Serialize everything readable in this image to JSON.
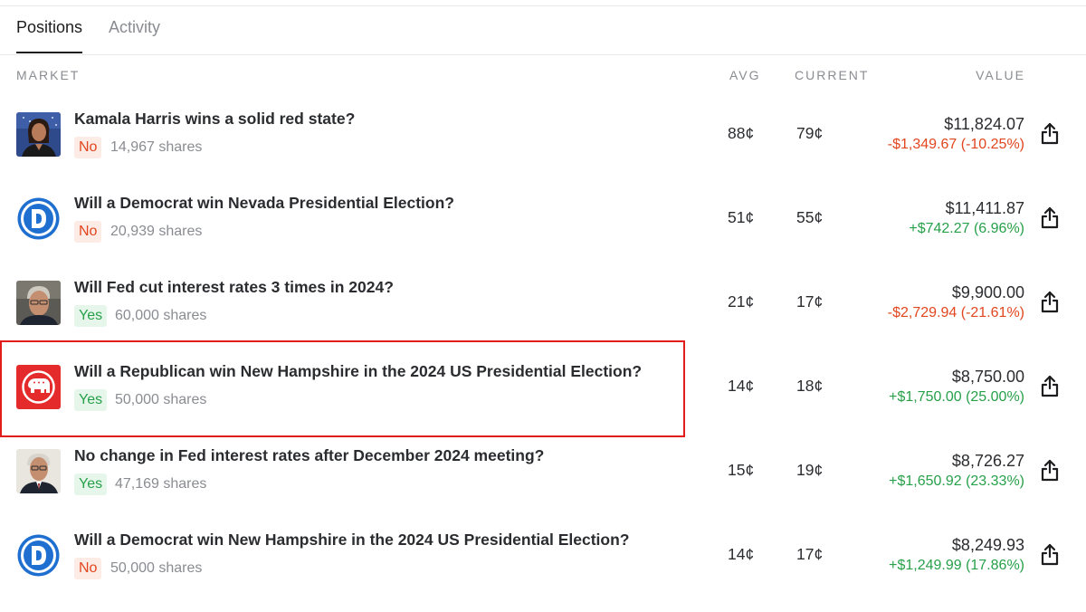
{
  "tabs": [
    {
      "label": "Positions",
      "active": true
    },
    {
      "label": "Activity",
      "active": false
    }
  ],
  "columns": {
    "market": "MARKET",
    "avg": "AVG",
    "current": "CURRENT",
    "value": "VALUE"
  },
  "positions": [
    {
      "title": "Kamala Harris wins a solid red state?",
      "outcome": "No",
      "shares": "14,967 shares",
      "avg": "88¢",
      "current": "79¢",
      "value": "$11,824.07",
      "pnl": "-$1,349.67 (-10.25%)",
      "pnl_direction": "negative",
      "thumbnail": "harris-photo"
    },
    {
      "title": "Will a Democrat win Nevada Presidential Election?",
      "outcome": "No",
      "shares": "20,939 shares",
      "avg": "51¢",
      "current": "55¢",
      "value": "$11,411.87",
      "pnl": "+$742.27 (6.96%)",
      "pnl_direction": "positive",
      "thumbnail": "democrat-logo"
    },
    {
      "title": "Will Fed cut interest rates 3 times in 2024?",
      "outcome": "Yes",
      "shares": "60,000 shares",
      "avg": "21¢",
      "current": "17¢",
      "value": "$9,900.00",
      "pnl": "-$2,729.94 (-21.61%)",
      "pnl_direction": "negative",
      "thumbnail": "powell-photo"
    },
    {
      "title": "Will a Republican win New Hampshire in the 2024 US Presidential Election?",
      "outcome": "Yes",
      "shares": "50,000 shares",
      "avg": "14¢",
      "current": "18¢",
      "value": "$8,750.00",
      "pnl": "+$1,750.00 (25.00%)",
      "pnl_direction": "positive",
      "thumbnail": "republican-logo",
      "highlighted": true
    },
    {
      "title": "No change in Fed interest rates after December 2024 meeting?",
      "outcome": "Yes",
      "shares": "47,169 shares",
      "avg": "15¢",
      "current": "19¢",
      "value": "$8,726.27",
      "pnl": "+$1,650.92 (23.33%)",
      "pnl_direction": "positive",
      "thumbnail": "powell-photo"
    },
    {
      "title": "Will a Democrat win New Hampshire in the 2024 US Presidential Election?",
      "outcome": "No",
      "shares": "50,000 shares",
      "avg": "14¢",
      "current": "17¢",
      "value": "$8,249.93",
      "pnl": "+$1,249.99 (17.86%)",
      "pnl_direction": "positive",
      "thumbnail": "democrat-logo"
    }
  ],
  "colors": {
    "text": "#2b2c2f",
    "muted": "#8a8c91",
    "negative": "#e1461f",
    "positive": "#27a04a",
    "no_pill_bg": "#fdebe5",
    "yes_pill_bg": "#e6f6ea",
    "democrat_blue": "#1f6fd1",
    "republican_red": "#e42a2a",
    "highlight_border": "#e21b1b"
  },
  "icons": {
    "share": "share-icon"
  }
}
